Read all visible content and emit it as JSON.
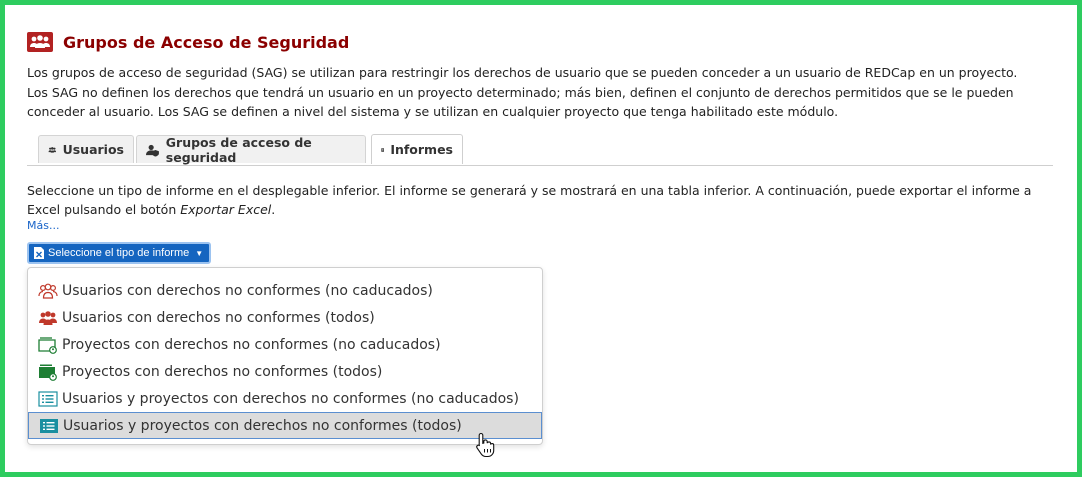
{
  "header": {
    "title": "Grupos de Acceso de Seguridad",
    "description": "Los grupos de acceso de seguridad (SAG) se utilizan para restringir los derechos de usuario que se pueden conceder a un usuario de REDCap en un proyecto. Los SAG no definen los derechos que tendrá un usuario en un proyecto determinado; más bien, definen el conjunto de derechos permitidos que se le pueden conceder al usuario. Los SAG se definen a nivel del sistema y se utilizan en cualquier proyecto que tenga habilitado este módulo."
  },
  "tabs": [
    {
      "label": "Usuarios",
      "icon": "users-icon",
      "active": false
    },
    {
      "label": "Grupos de acceso de seguridad",
      "icon": "user-shield-icon",
      "active": false
    },
    {
      "label": "Informes",
      "icon": "report-icon",
      "active": true
    }
  ],
  "info": {
    "text_before": "Seleccione un tipo de informe en el desplegable inferior. El informe se generará y se mostrará en una tabla inferior. A continuación, puede exportar el informe a Excel pulsando el botón ",
    "text_italic": "Exportar Excel",
    "text_after": ".",
    "more_link": "Más..."
  },
  "dropdown": {
    "button_label": "Seleccione el tipo de informe",
    "items": [
      {
        "label": "Usuarios con derechos no conformes (no caducados)",
        "icon": "users-outline-icon"
      },
      {
        "label": "Usuarios con derechos no conformes (todos)",
        "icon": "users-solid-icon"
      },
      {
        "label": "Proyectos con derechos no conformes (no caducados)",
        "icon": "folder-outline-icon"
      },
      {
        "label": "Proyectos con derechos no conformes (todos)",
        "icon": "folder-solid-icon"
      },
      {
        "label": "Usuarios y proyectos con derechos no conformes (no caducados)",
        "icon": "list-outline-icon"
      },
      {
        "label": "Usuarios y proyectos con derechos no conformes (todos)",
        "icon": "list-solid-icon"
      }
    ],
    "hovered_index": 5
  },
  "colors": {
    "title": "#8b0000",
    "accent_button": "#1565c0",
    "border_frame": "#2ecc5f",
    "red_icon": "#c0392b",
    "green_icon": "#1e7e34",
    "teal_icon": "#1a8fa0"
  }
}
